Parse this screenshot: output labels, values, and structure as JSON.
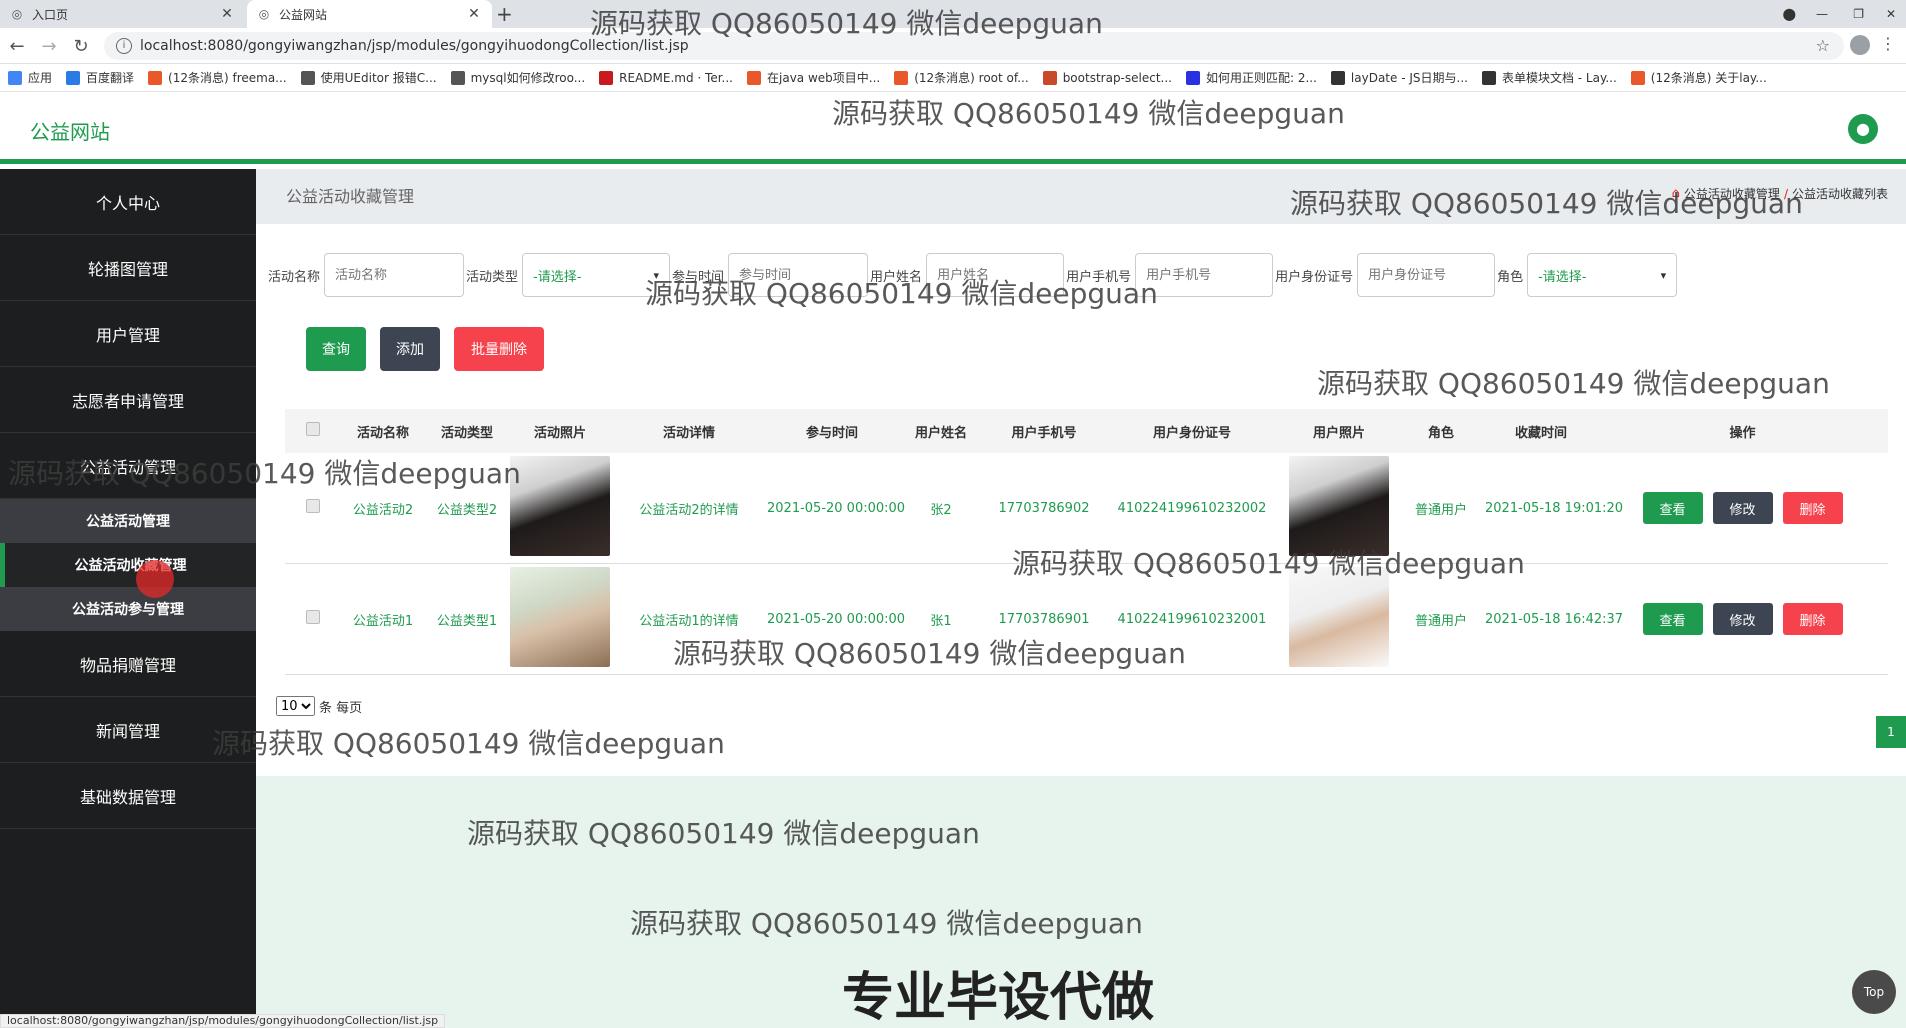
{
  "browser": {
    "tabs": [
      {
        "title": "入口页",
        "active": false
      },
      {
        "title": "公益网站",
        "active": true
      }
    ],
    "url": "localhost:8080/gongyiwangzhan/jsp/modules/gongyihuodongCollection/list.jsp",
    "bookmarks": [
      {
        "label": "应用",
        "color": "#4285f4",
        "icon": "apps-icon"
      },
      {
        "label": "百度翻译",
        "color": "#2b7be5",
        "icon": "translate-icon"
      },
      {
        "label": "(12条消息) freema...",
        "color": "#e8582b",
        "icon": "csdn-icon"
      },
      {
        "label": "使用UEditor 报错C...",
        "color": "#555555",
        "icon": "bookmark-icon"
      },
      {
        "label": "mysql如何修改roo...",
        "color": "#555555",
        "icon": "bookmark-icon"
      },
      {
        "label": "README.md · Ter...",
        "color": "#c7191e",
        "icon": "gitee-icon"
      },
      {
        "label": "在java web项目中...",
        "color": "#e8582b",
        "icon": "csdn-icon"
      },
      {
        "label": "(12条消息) root of...",
        "color": "#e8582b",
        "icon": "csdn-icon"
      },
      {
        "label": "bootstrap-select...",
        "color": "#c94a2a",
        "icon": "bookmark-icon"
      },
      {
        "label": "如何用正则匹配: 2...",
        "color": "#2932e1",
        "icon": "baidu-icon"
      },
      {
        "label": "layDate - JS日期与...",
        "color": "#333333",
        "icon": "layui-icon"
      },
      {
        "label": "表单模块文档 - Lay...",
        "color": "#333333",
        "icon": "layui-icon"
      },
      {
        "label": "(12条消息) 关于lay...",
        "color": "#e8582b",
        "icon": "csdn-icon"
      }
    ],
    "status_url": "localhost:8080/gongyiwangzhan/jsp/modules/gongyihuodongCollection/list.jsp"
  },
  "header": {
    "brand": "公益网站",
    "avatar_icon": "user-avatar-icon"
  },
  "sidebar": {
    "items_top": [
      "个人中心",
      "轮播图管理",
      "用户管理",
      "志愿者申请管理",
      "公益活动管理"
    ],
    "submenu": [
      {
        "label": "公益活动管理",
        "active": false
      },
      {
        "label": "公益活动收藏管理",
        "active": true
      },
      {
        "label": "公益活动参与管理",
        "active": false
      }
    ],
    "items_bottom": [
      "物品捐赠管理",
      "新闻管理",
      "基础数据管理"
    ]
  },
  "page": {
    "title": "公益活动收藏管理",
    "breadcrumb": [
      "公益活动收藏管理",
      "公益活动收藏列表"
    ]
  },
  "search": {
    "activity_name_label": "活动名称",
    "activity_name_placeholder": "活动名称",
    "activity_type_label": "活动类型",
    "activity_type_value": "-请选择-",
    "join_time_label": "参与时间",
    "join_time_placeholder": "参与时间",
    "user_name_label": "用户姓名",
    "user_name_placeholder": "用户姓名",
    "user_phone_label": "用户手机号",
    "user_phone_placeholder": "用户手机号",
    "user_id_label": "用户身份证号",
    "user_id_placeholder": "用户身份证号",
    "role_label": "角色",
    "role_value": "-请选择-"
  },
  "actions": {
    "query": "查询",
    "add": "添加",
    "batch_delete": "批量删除"
  },
  "table": {
    "headers": [
      "活动名称",
      "活动类型",
      "活动照片",
      "活动详情",
      "参与时间",
      "用户姓名",
      "用户手机号",
      "用户身份证号",
      "用户照片",
      "角色",
      "收藏时间",
      "操作"
    ],
    "rows": [
      {
        "name": "公益活动2",
        "type": "公益类型2",
        "detail": "公益活动2的详情",
        "time": "2021-05-20 00:00:00",
        "user": "张2",
        "phone": "17703786902",
        "id_card": "410224199610232002",
        "role": "普通用户",
        "collect_time": "2021-05-18 19:01:20"
      },
      {
        "name": "公益活动1",
        "type": "公益类型1",
        "detail": "公益活动1的详情",
        "time": "2021-05-20 00:00:00",
        "user": "张1",
        "phone": "17703786901",
        "id_card": "410224199610232001",
        "role": "普通用户",
        "collect_time": "2021-05-18 16:42:37"
      }
    ],
    "ops": {
      "view": "查看",
      "edit": "修改",
      "delete": "删除"
    }
  },
  "pagination": {
    "page_size": "10",
    "per_page_label": "条 每页",
    "current_page": "1"
  },
  "top_button": "Top",
  "watermark": {
    "text": "源码获取 QQ86050149 微信deepguan",
    "big": "专业毕设代做"
  },
  "colors": {
    "primary_green": "#1f9b4f",
    "dark_button": "#3d4553",
    "danger_red": "#f5424d",
    "sidebar_bg": "#1d1e1f"
  }
}
